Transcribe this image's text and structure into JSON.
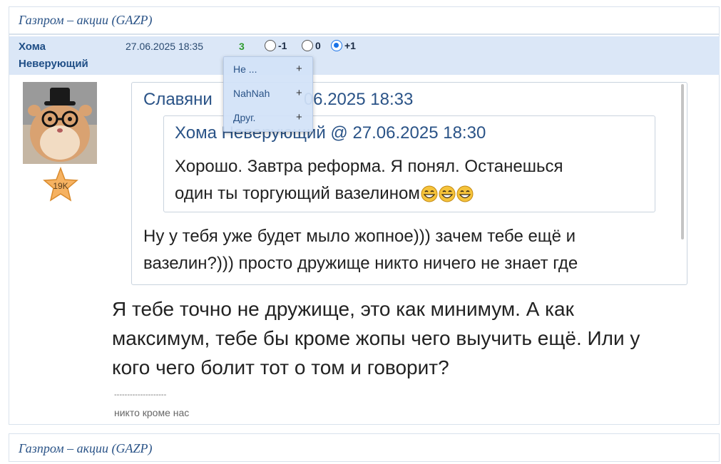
{
  "topic_title": "Газпром – акции (GAZP)",
  "post": {
    "author_first": "Хома",
    "author_second": "Неверующий",
    "date": "27.06.2025 18:35",
    "rating": "3",
    "vote_options": [
      "-1",
      "0",
      "+1"
    ],
    "selected_vote": "+1",
    "badge": "19K",
    "quote_outer_title": "Славяни",
    "quote_outer_title_rest": "06.2025 18:33",
    "quote_inner_title": "Хома Неверующий @ 27.06.2025 18:30",
    "quote_inner_line1": "Хорошо. Завтра реформа. Я понял. Останешься",
    "quote_inner_line2": "один ты торгующий вазелином",
    "quote_outer_line1": "Ну у тебя уже будет мыло жопное))) зачем тебе ещё и",
    "quote_outer_line2": "вазелин?))) просто дружище никто ничего не знает где",
    "body_line1": "Я тебе точно не дружище, это как минимум. А как",
    "body_line2": "максимум, тебе бы кроме жопы чего выучить ещё. Или у",
    "body_line3": "кого чего болит тот о том и говорит?",
    "signature_divider": "--------------------",
    "signature": "никто кроме нас"
  },
  "popup_menu": [
    {
      "label": "Не ...",
      "plus": "+"
    },
    {
      "label": "NahNah",
      "plus": "+"
    },
    {
      "label": "Друг.",
      "plus": "+"
    }
  ],
  "emoji_icon": "grinning-face-icon",
  "colors": {
    "link": "#2a5387",
    "header_band": "#dbe7f7",
    "rating": "#2e9b2e",
    "radio_selected": "#1a73e8"
  }
}
